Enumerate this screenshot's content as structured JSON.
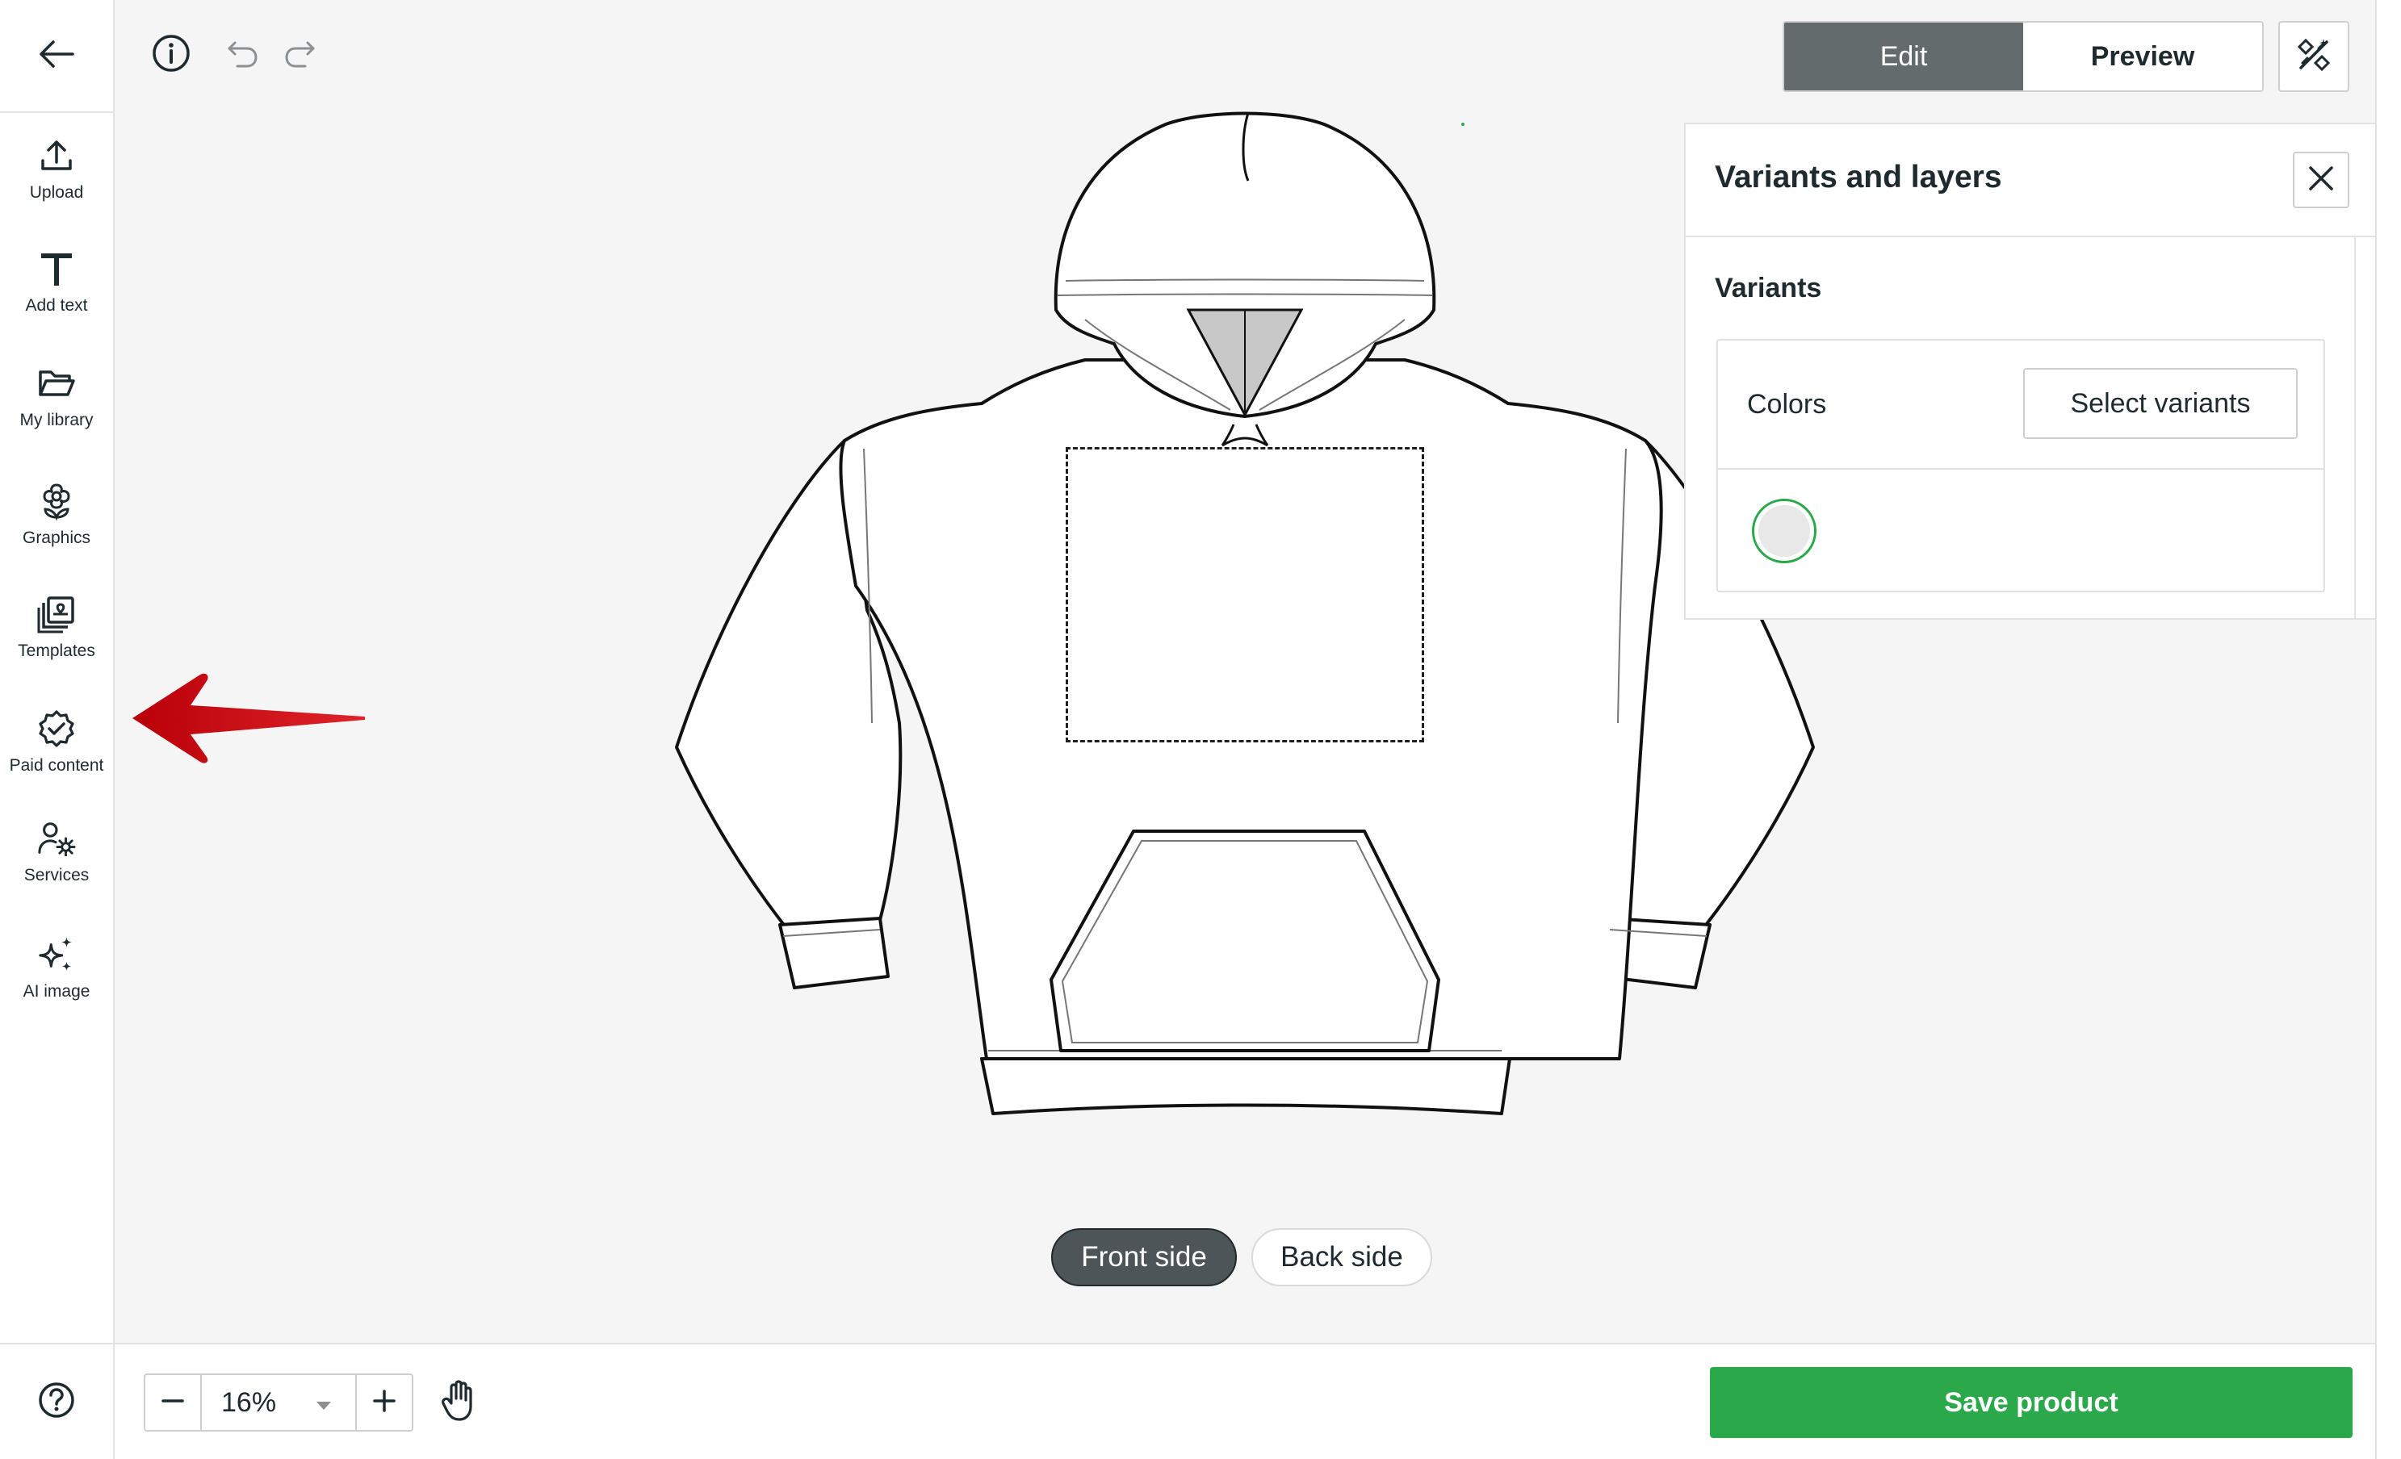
{
  "sidebar": {
    "back_icon": "arrow-left-icon",
    "items": [
      {
        "label": "Upload",
        "icon": "upload-icon"
      },
      {
        "label": "Add text",
        "icon": "text-icon"
      },
      {
        "label": "My library",
        "icon": "folder-icon"
      },
      {
        "label": "Graphics",
        "icon": "flower-icon"
      },
      {
        "label": "Templates",
        "icon": "templates-icon"
      },
      {
        "label": "Paid content",
        "icon": "verified-badge-icon"
      },
      {
        "label": "Services",
        "icon": "user-settings-icon"
      },
      {
        "label": "AI image",
        "icon": "sparkles-icon"
      }
    ],
    "help_icon": "help-circle-icon"
  },
  "toolbar": {
    "info_icon": "info-icon",
    "undo_icon": "undo-icon",
    "redo_icon": "redo-icon",
    "mode": {
      "edit_label": "Edit",
      "preview_label": "Preview",
      "active": "Edit"
    },
    "magic_icon": "magic-tools-icon"
  },
  "canvas": {
    "product_icon": "hoodie-outline",
    "front_label": "Front side",
    "back_label": "Back side",
    "active_side": "Front side"
  },
  "annotation": {
    "color": "#d10a12",
    "icon": "red-arrow-left"
  },
  "panel": {
    "title": "Variants and layers",
    "close_icon": "close-icon",
    "variants_title": "Variants",
    "colors_label": "Colors",
    "select_variants_label": "Select variants",
    "selected_color": "#e8e8e8"
  },
  "bottom": {
    "zoom_value": "16%",
    "hand_icon": "hand-pan-icon",
    "save_label": "Save product",
    "save_color": "#2aa84a"
  }
}
